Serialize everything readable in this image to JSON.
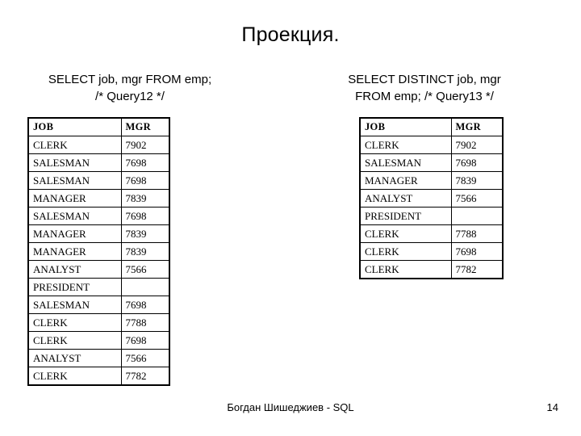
{
  "slide": {
    "title": "Проекция.",
    "footer_text": "Богдан Шишеджиев - SQL",
    "page_number": "14",
    "background_color": "#ffffff",
    "text_color": "#000000"
  },
  "left_panel": {
    "caption": "SELECT job, mgr FROM emp;\n/* Query12 */",
    "table": {
      "columns": [
        "JOB",
        "MGR"
      ],
      "rows": [
        [
          "CLERK",
          "7902"
        ],
        [
          "SALESMAN",
          "7698"
        ],
        [
          "SALESMAN",
          "7698"
        ],
        [
          "MANAGER",
          "7839"
        ],
        [
          "SALESMAN",
          "7698"
        ],
        [
          "MANAGER",
          "7839"
        ],
        [
          "MANAGER",
          "7839"
        ],
        [
          "ANALYST",
          "7566"
        ],
        [
          "PRESIDENT",
          ""
        ],
        [
          "SALESMAN",
          "7698"
        ],
        [
          "CLERK",
          "7788"
        ],
        [
          "CLERK",
          "7698"
        ],
        [
          "ANALYST",
          "7566"
        ],
        [
          "CLERK",
          "7782"
        ]
      ]
    }
  },
  "right_panel": {
    "caption": "SELECT DISTINCT job, mgr\nFROM emp; /* Query13 */",
    "table": {
      "columns": [
        "JOB",
        "MGR"
      ],
      "rows": [
        [
          "CLERK",
          "7902"
        ],
        [
          "SALESMAN",
          "7698"
        ],
        [
          "MANAGER",
          "7839"
        ],
        [
          "ANALYST",
          "7566"
        ],
        [
          "PRESIDENT",
          ""
        ],
        [
          "CLERK",
          "7788"
        ],
        [
          "CLERK",
          "7698"
        ],
        [
          "CLERK",
          "7782"
        ]
      ]
    }
  }
}
